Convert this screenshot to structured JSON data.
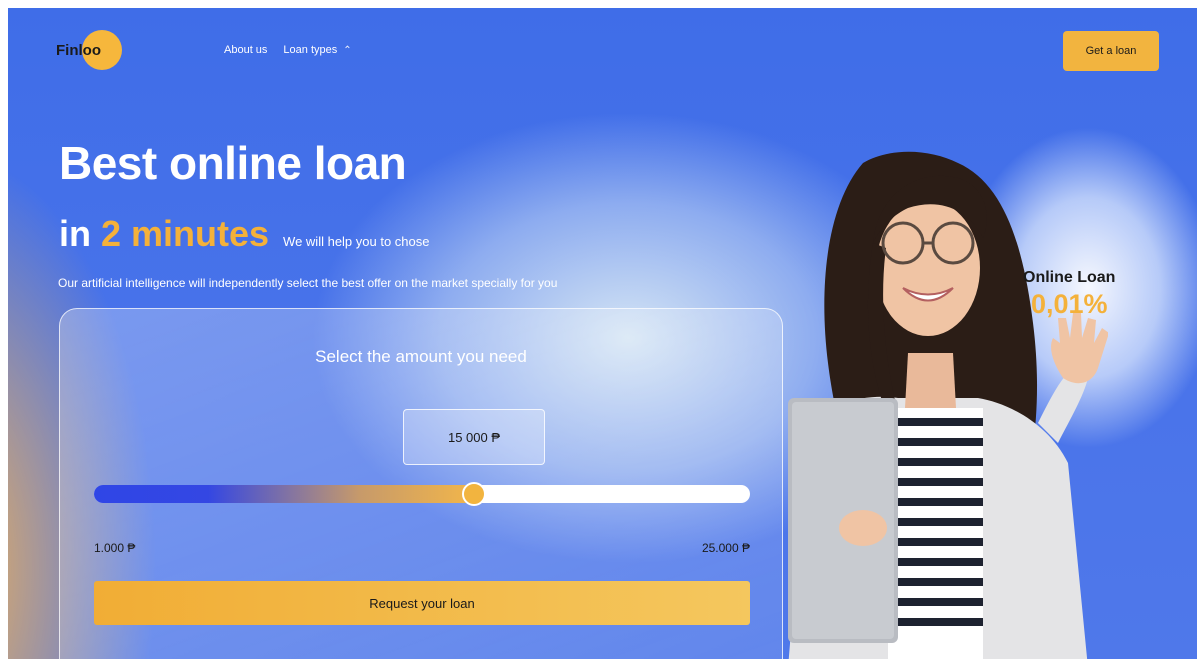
{
  "header": {
    "logo_text": "Finl",
    "logo_oo": "oo",
    "nav": [
      {
        "label": "About us"
      },
      {
        "label": "Loan types",
        "chevron": "chevron-up-icon"
      }
    ],
    "cta_label": "Get a loan"
  },
  "hero": {
    "title": "Best online loan",
    "line2_prefix": "in",
    "line2_accent": "2 minutes",
    "line2_small": "We will help you to chose",
    "subtitle": "Our artificial intelligence will independently select the best offer on the market specially for you"
  },
  "calculator": {
    "title": "Select the amount you need",
    "amount": "15 000 ₱",
    "slider_min_label": "1.000 ₱",
    "slider_max_label": "25.000 ₱",
    "slider_fraction": 0.58,
    "button_label": "Request your loan"
  },
  "promo": {
    "label": "Online Loan",
    "rate": "0,01%"
  },
  "colors": {
    "background": "#4a74ea",
    "accent": "#f4b13a",
    "slider_blue": "#2f46e6"
  }
}
